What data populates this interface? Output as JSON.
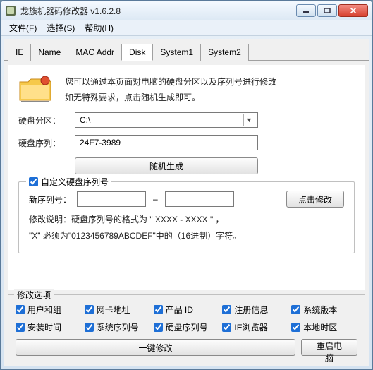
{
  "window": {
    "title": "龙族机器码修改器 v1.6.2.8"
  },
  "menu": {
    "file": "文件(F)",
    "select": "选择(S)",
    "help": "帮助(H)"
  },
  "tabs": {
    "ie": "IE",
    "name": "Name",
    "mac": "MAC Addr",
    "disk": "Disk",
    "sys1": "System1",
    "sys2": "System2"
  },
  "intro": {
    "line1": "您可以通过本页面对电脑的硬盘分区以及序列号进行修改",
    "line2": "如无特殊要求，点击随机生成即可。"
  },
  "form": {
    "partition_label": "硬盘分区：",
    "partition_value": "C:\\",
    "serial_label": "硬盘序列：",
    "serial_value": "24F7-3989",
    "gen_btn": "随机生成"
  },
  "custom": {
    "legend": "自定义硬盘序列号",
    "new_serial_label": "新序列号：",
    "sn_a": "",
    "sn_b": "",
    "modify_btn": "点击修改",
    "note1": "修改说明：硬盘序列号的格式为 \" XXXX - XXXX \" ，",
    "note2": "\"X\" 必须为\"0123456789ABCDEF\"中的（16进制）字符。"
  },
  "options": {
    "legend": "修改选项",
    "items": [
      "用户和组",
      "网卡地址",
      "产品 ID",
      "注册信息",
      "系统版本",
      "安装时间",
      "系统序列号",
      "硬盘序列号",
      "IE浏览器",
      "本地时区"
    ],
    "apply_btn": "一键修改",
    "restart_btn": "重启电脑"
  }
}
